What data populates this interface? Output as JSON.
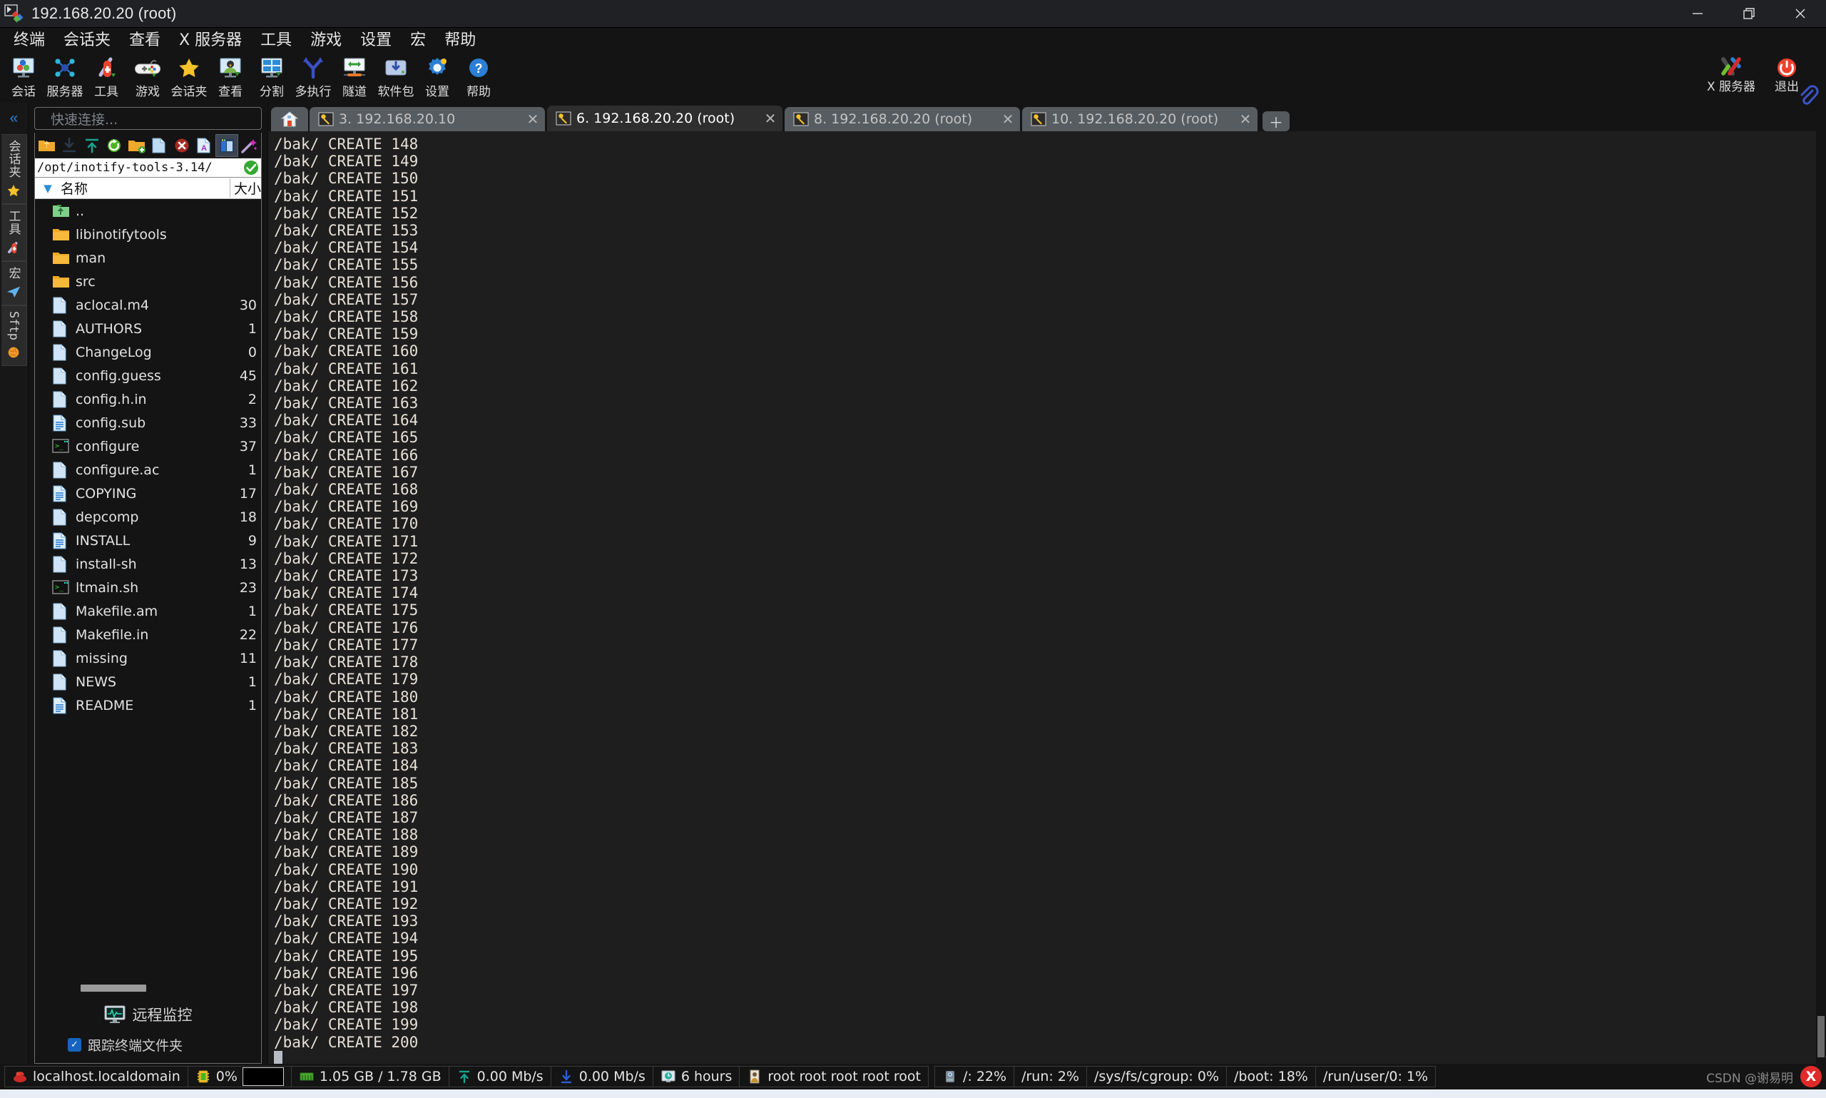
{
  "window": {
    "title": "192.168.20.20 (root)",
    "app_icon": "mobaxterm-icon",
    "controls": [
      {
        "name": "minimize-button",
        "glyph": "—"
      },
      {
        "name": "maximize-button",
        "glyph": "❐"
      },
      {
        "name": "close-button",
        "glyph": "✕"
      }
    ]
  },
  "menubar": {
    "items": [
      {
        "label": "终端",
        "name": "menu-terminal"
      },
      {
        "label": "会话夹",
        "name": "menu-sessions"
      },
      {
        "label": "查看",
        "name": "menu-view"
      },
      {
        "label": "X 服务器",
        "name": "menu-xserver"
      },
      {
        "label": "工具",
        "name": "menu-tools"
      },
      {
        "label": "游戏",
        "name": "menu-games"
      },
      {
        "label": "设置",
        "name": "menu-settings"
      },
      {
        "label": "宏",
        "name": "menu-macros"
      },
      {
        "label": "帮助",
        "name": "menu-help"
      }
    ]
  },
  "toolbar": {
    "buttons": [
      {
        "label": "会话",
        "icon": "session-icon"
      },
      {
        "label": "服务器",
        "icon": "servers-icon"
      },
      {
        "label": "工具",
        "icon": "tools-icon"
      },
      {
        "label": "游戏",
        "icon": "games-icon"
      },
      {
        "label": "会话夹",
        "icon": "star-icon"
      },
      {
        "label": "查看",
        "icon": "view-icon"
      },
      {
        "label": "分割",
        "icon": "split-icon"
      },
      {
        "label": "多执行",
        "icon": "multiexec-icon"
      },
      {
        "label": "隧道",
        "icon": "tunnel-icon"
      },
      {
        "label": "软件包",
        "icon": "packages-icon"
      },
      {
        "label": "设置",
        "icon": "gear-icon"
      },
      {
        "label": "帮助",
        "icon": "help-icon"
      }
    ],
    "right_buttons": [
      {
        "label": "X 服务器",
        "icon": "xserver-icon"
      },
      {
        "label": "退出",
        "icon": "exit-icon"
      }
    ]
  },
  "rail": {
    "collapse_icon": "chevron-double-left-icon",
    "tabs": [
      {
        "label": "会话夹",
        "icon": "star-icon",
        "latin": false
      },
      {
        "label": "工具",
        "icon": "knife-icon",
        "latin": false
      },
      {
        "label": "宏",
        "icon": "paperplane-icon",
        "latin": false
      },
      {
        "label": "Sftp",
        "icon": "globe-icon",
        "latin": true
      }
    ]
  },
  "panel": {
    "quick_connect_placeholder": "快速连接...",
    "sftp_toolbar": [
      {
        "name": "parent-dir-icon",
        "selected": false
      },
      {
        "name": "download-icon",
        "selected": false
      },
      {
        "name": "upload-icon",
        "selected": false
      },
      {
        "name": "refresh-icon",
        "selected": false
      },
      {
        "name": "new-folder-icon",
        "selected": false
      },
      {
        "name": "new-file-icon",
        "selected": false
      },
      {
        "name": "delete-icon",
        "selected": false
      },
      {
        "name": "text-edit-icon",
        "selected": false
      },
      {
        "name": "split-view-icon",
        "selected": true
      },
      {
        "name": "magic-wand-icon",
        "selected": false
      }
    ],
    "path_value": "/opt/inotify-tools-3.14/",
    "path_ok_icon": "check-icon",
    "columns": {
      "name": "名称",
      "size": "大小"
    },
    "files": [
      {
        "name": "..",
        "size": "",
        "icon": "parent-folder-icon"
      },
      {
        "name": "libinotifytools",
        "size": "",
        "icon": "folder-icon"
      },
      {
        "name": "man",
        "size": "",
        "icon": "folder-icon"
      },
      {
        "name": "src",
        "size": "",
        "icon": "folder-icon"
      },
      {
        "name": "aclocal.m4",
        "size": "30",
        "icon": "file-icon"
      },
      {
        "name": "AUTHORS",
        "size": "1",
        "icon": "file-icon"
      },
      {
        "name": "ChangeLog",
        "size": "0",
        "icon": "file-icon"
      },
      {
        "name": "config.guess",
        "size": "45",
        "icon": "file-icon"
      },
      {
        "name": "config.h.in",
        "size": "2",
        "icon": "file-icon"
      },
      {
        "name": "config.sub",
        "size": "33",
        "icon": "textfile-icon"
      },
      {
        "name": "configure",
        "size": "37",
        "icon": "script-icon"
      },
      {
        "name": "configure.ac",
        "size": "1",
        "icon": "file-icon"
      },
      {
        "name": "COPYING",
        "size": "17",
        "icon": "textfile-icon"
      },
      {
        "name": "depcomp",
        "size": "18",
        "icon": "file-icon"
      },
      {
        "name": "INSTALL",
        "size": "9",
        "icon": "textfile-icon"
      },
      {
        "name": "install-sh",
        "size": "13",
        "icon": "file-icon"
      },
      {
        "name": "ltmain.sh",
        "size": "23",
        "icon": "script-icon"
      },
      {
        "name": "Makefile.am",
        "size": "1",
        "icon": "file-icon"
      },
      {
        "name": "Makefile.in",
        "size": "22",
        "icon": "file-icon"
      },
      {
        "name": "missing",
        "size": "11",
        "icon": "file-icon"
      },
      {
        "name": "NEWS",
        "size": "1",
        "icon": "file-icon"
      },
      {
        "name": "README",
        "size": "1",
        "icon": "textfile-icon"
      }
    ],
    "monitor_label": "远程监控",
    "monitor_icon": "monitor-icon",
    "follow_label": "跟踪终端文件夹",
    "follow_checked": true
  },
  "tabs": {
    "home_icon": "home-icon",
    "new_tab_glyph": "＋",
    "items": [
      {
        "label": "3. 192.168.20.10",
        "active": false,
        "icon": "key-icon",
        "close": "✕"
      },
      {
        "label": "6. 192.168.20.20 (root)",
        "active": true,
        "icon": "key-icon",
        "close": "✕"
      },
      {
        "label": "8. 192.168.20.20 (root)",
        "active": false,
        "icon": "key-icon",
        "close": "✕"
      },
      {
        "label": "10. 192.168.20.20 (root)",
        "active": false,
        "icon": "key-icon",
        "close": "✕"
      }
    ]
  },
  "terminal": {
    "lines": [
      "/bak/ CREATE 148",
      "/bak/ CREATE 149",
      "/bak/ CREATE 150",
      "/bak/ CREATE 151",
      "/bak/ CREATE 152",
      "/bak/ CREATE 153",
      "/bak/ CREATE 154",
      "/bak/ CREATE 155",
      "/bak/ CREATE 156",
      "/bak/ CREATE 157",
      "/bak/ CREATE 158",
      "/bak/ CREATE 159",
      "/bak/ CREATE 160",
      "/bak/ CREATE 161",
      "/bak/ CREATE 162",
      "/bak/ CREATE 163",
      "/bak/ CREATE 164",
      "/bak/ CREATE 165",
      "/bak/ CREATE 166",
      "/bak/ CREATE 167",
      "/bak/ CREATE 168",
      "/bak/ CREATE 169",
      "/bak/ CREATE 170",
      "/bak/ CREATE 171",
      "/bak/ CREATE 172",
      "/bak/ CREATE 173",
      "/bak/ CREATE 174",
      "/bak/ CREATE 175",
      "/bak/ CREATE 176",
      "/bak/ CREATE 177",
      "/bak/ CREATE 178",
      "/bak/ CREATE 179",
      "/bak/ CREATE 180",
      "/bak/ CREATE 181",
      "/bak/ CREATE 182",
      "/bak/ CREATE 183",
      "/bak/ CREATE 184",
      "/bak/ CREATE 185",
      "/bak/ CREATE 186",
      "/bak/ CREATE 187",
      "/bak/ CREATE 188",
      "/bak/ CREATE 189",
      "/bak/ CREATE 190",
      "/bak/ CREATE 191",
      "/bak/ CREATE 192",
      "/bak/ CREATE 193",
      "/bak/ CREATE 194",
      "/bak/ CREATE 195",
      "/bak/ CREATE 196",
      "/bak/ CREATE 197",
      "/bak/ CREATE 198",
      "/bak/ CREATE 199",
      "/bak/ CREATE 200"
    ]
  },
  "statusbar": {
    "hostname": "localhost.localdomain",
    "host_icon": "redhat-icon",
    "cpu": "0%",
    "cpu_icon": "cpu-icon",
    "memory": "1.05 GB / 1.78 GB",
    "memory_icon": "ram-icon",
    "upload": "0.00 Mb/s",
    "upload_icon": "upload-arrow-icon",
    "download": "0.00 Mb/s",
    "download_icon": "download-arrow-icon",
    "uptime": "6 hours",
    "uptime_icon": "clock-icon",
    "users": "root  root  root  root  root",
    "users_icon": "user-icon",
    "disk_icon": "disk-icon",
    "disks": [
      "/: 22%",
      "/run: 2%",
      "/sys/fs/cgroup: 0%",
      "/boot: 18%",
      "/run/user/0: 1%"
    ],
    "watermark": "CSDN @谢易明"
  },
  "colors": {
    "accent": "#2b7fd4",
    "terminal_bg": "#1e1e1e",
    "terminal_fg": "#e6e0d6",
    "panel_bg": "#141414",
    "tab_inactive": "#575c60",
    "tab_active": "#2e2e2e",
    "checkbox": "#1565c0"
  }
}
